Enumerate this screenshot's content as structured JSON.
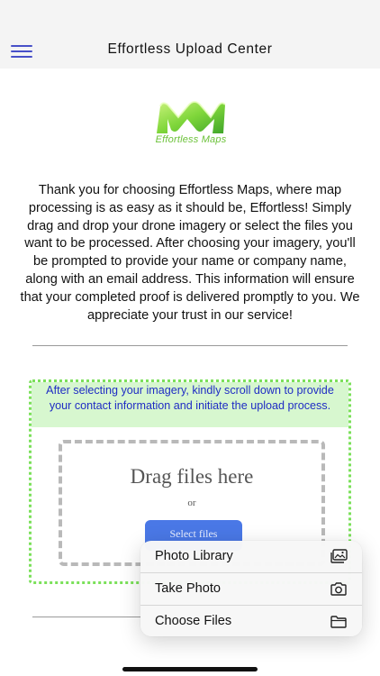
{
  "header": {
    "title": "Effortless Upload Center"
  },
  "logo": {
    "text": "Effortless Maps"
  },
  "intro": {
    "text": "Thank you for choosing Effortless Maps, where map processing is as easy as it should be, Effortless! Simply drag and drop your drone imagery or select the files you want to be processed. After choosing your imagery, you'll be prompted to provide your name or company name, along with an email address. This information will ensure that your completed proof is delivered promptly to you. We appreciate your trust in our service!"
  },
  "upload": {
    "notice": "After selecting your imagery, kindly scroll down to provide your contact information and initiate the upload process.",
    "drag_title": "Drag files here",
    "or_text": "or",
    "select_button": "Select files"
  },
  "file_menu": {
    "items": [
      {
        "label": "Photo Library",
        "icon": "photo-library-icon"
      },
      {
        "label": "Take Photo",
        "icon": "camera-icon"
      },
      {
        "label": "Choose Files",
        "icon": "folder-icon"
      }
    ]
  },
  "colors": {
    "accent_blue": "#4a78e6",
    "notice_text": "#1f2cc4",
    "notice_bg": "#d7f7cf",
    "dotted_border": "#7be05a",
    "hamburger": "#4850c8",
    "logo_green": "#6cc23a"
  }
}
